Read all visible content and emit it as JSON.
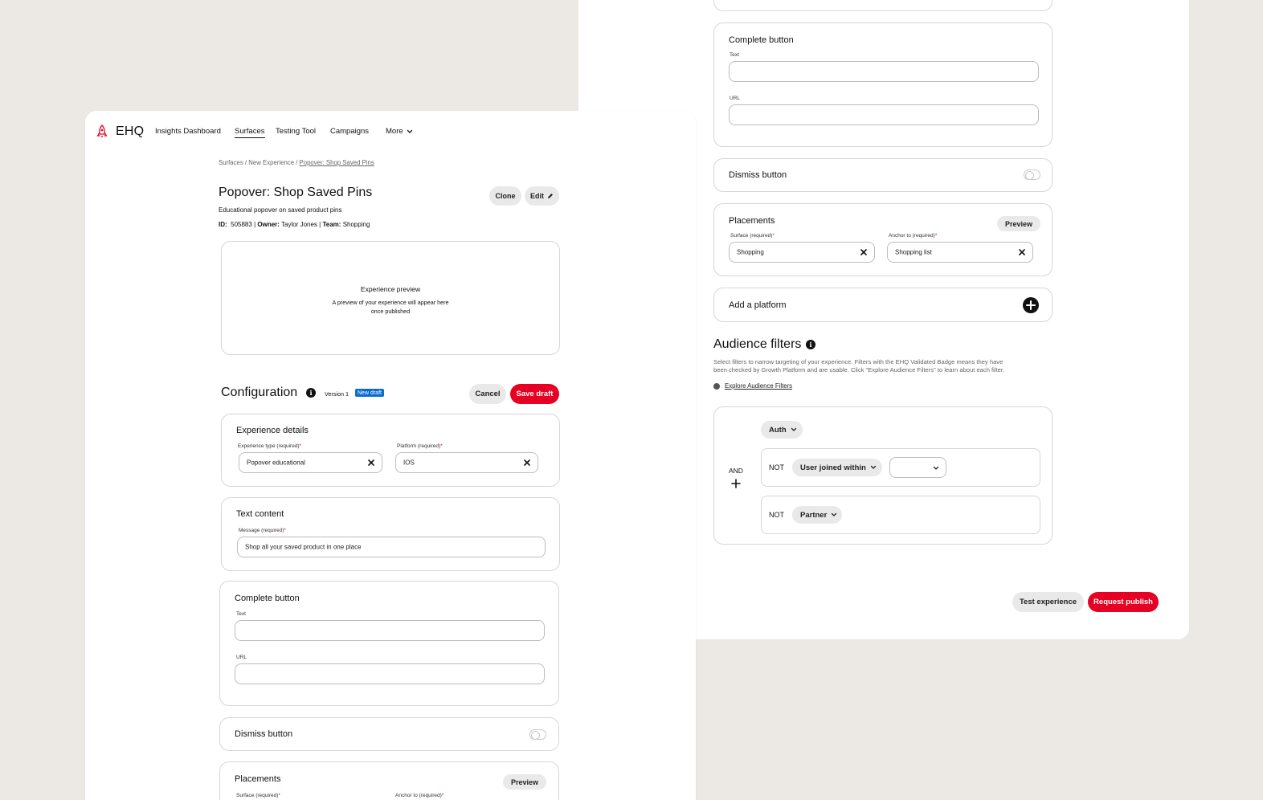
{
  "app": {
    "logo_text": "EHQ",
    "brand_color": "#e60023"
  },
  "nav": {
    "items": [
      {
        "label": "Insights Dashboard"
      },
      {
        "label": "Surfaces"
      },
      {
        "label": "Testing Tool"
      },
      {
        "label": "Campaigns"
      },
      {
        "label": "More"
      }
    ]
  },
  "breadcrumb": {
    "part1": "Surfaces / New Experience /",
    "current": "Popover: Shop Saved Pins"
  },
  "experience": {
    "title": "Popover: Shop Saved Pins",
    "description": "Educational popover on saved product pins",
    "id_label": "ID:",
    "id_value": "505883",
    "owner_label": "Owner:",
    "owner_value": "Taylor Jones",
    "team_label": "Team:",
    "team_value": "Shopping",
    "sep": "|",
    "clone_label": "Clone",
    "edit_label": "Edit"
  },
  "preview": {
    "title": "Experience preview",
    "line1": "A preview of your experience will appear here",
    "line2": "once published"
  },
  "configuration": {
    "title": "Configuration",
    "version": "Version 1",
    "badge": "New draft",
    "cancel_label": "Cancel",
    "save_label": "Save draft"
  },
  "experience_details": {
    "title": "Experience details",
    "type_label": "Experience type (required)",
    "type_value": "Popover educational",
    "platform_label": "Platform (required)",
    "platform_value": "IOS",
    "required_mark": "*"
  },
  "text_content": {
    "title": "Text content",
    "message_label": "Message (required)",
    "message_value": "Shop all your saved product in one place"
  },
  "complete_button": {
    "title": "Complete button",
    "text_label": "Text",
    "text_value": "",
    "url_label": "URL",
    "url_value": ""
  },
  "dismiss_button": {
    "title": "Dismiss button",
    "enabled": false
  },
  "placements": {
    "title": "Placements",
    "preview_label": "Preview",
    "surface_label": "Surface (required)",
    "surface_value": "Shopping",
    "anchor_label": "Anchor to (required)",
    "anchor_value": "Shopping list"
  },
  "add_platform": {
    "label": "Add a platform"
  },
  "audience": {
    "title": "Audience filters",
    "description_line1": "Select filters to narrow targeting of your experience. Filters with the EHQ Validated Badge means they have",
    "description_line2": "been checked by Growth Platform and are usable. Click \"Explore Audience Filters\" to learn about each filter.",
    "explore_link": "Explore Audience Filters",
    "group_operator": "AND",
    "auth_chip": "Auth",
    "rule1_not": "NOT",
    "rule1_chip": "User joined within",
    "rule1_value": "",
    "rule2_not": "NOT",
    "rule2_chip": "Partner"
  },
  "footer": {
    "test_label": "Test experience",
    "publish_label": "Request publish"
  }
}
